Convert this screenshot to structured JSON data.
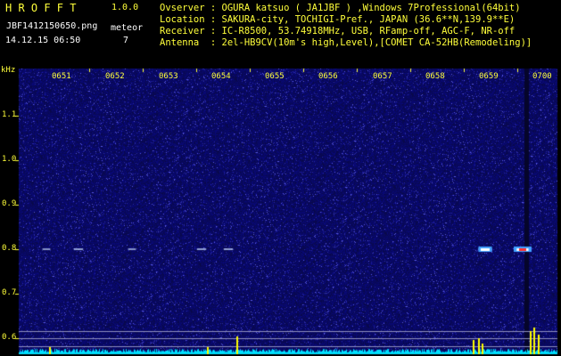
{
  "header": {
    "app_title": "H R O F F T",
    "version": "1.0.0",
    "filename": "JBF1412150650.png",
    "meteor_label": "meteor",
    "datetime": "14.12.15 06:50",
    "meteor_count": "7"
  },
  "info": [
    "Ovserver : OGURA katsuo ( JA1JBF ) ,Windows 7Professional(64bit)",
    "Location : SAKURA-city, TOCHIGI-Pref., JAPAN (36.6**N,139.9**E)",
    "Receiver : IC-R8500, 53.74918MHz, USB, RFamp-off, AGC-F, NR-off",
    "Antenna  : 2el-HB9CV(10m's high,Level),[COMET CA-52HB(Remodeling)]"
  ],
  "y_axis": {
    "unit": "kHz",
    "ticks": [
      "1.1",
      "1.0",
      "0.9",
      "0.8",
      "0.7",
      "0.6"
    ],
    "tick_values": [
      1.1,
      1.0,
      0.9,
      0.8,
      0.7,
      0.6
    ]
  },
  "x_axis": {
    "ticks": [
      "0651",
      "0652",
      "0653",
      "0654",
      "0655",
      "0656",
      "0657",
      "0658",
      "0659",
      "0700"
    ]
  },
  "colors": {
    "text_yellow": "#ffff3a",
    "background": "#000000",
    "spectrogram_base": "#10106a",
    "level_trace": "#00e0ff",
    "echo_peak": "#ffff00"
  },
  "echoes": [
    {
      "minute": 0.2,
      "freq_khz": 0.8,
      "strength": 0.3
    },
    {
      "minute": 0.8,
      "freq_khz": 0.8,
      "strength": 0.4
    },
    {
      "minute": 1.8,
      "freq_khz": 0.8,
      "strength": 0.3
    },
    {
      "minute": 3.1,
      "freq_khz": 0.8,
      "strength": 0.4
    },
    {
      "minute": 3.6,
      "freq_khz": 0.8,
      "strength": 0.4
    },
    {
      "minute": 8.4,
      "freq_khz": 0.8,
      "strength": 0.7
    },
    {
      "minute": 9.1,
      "freq_khz": 0.8,
      "strength": 1.0
    }
  ]
}
